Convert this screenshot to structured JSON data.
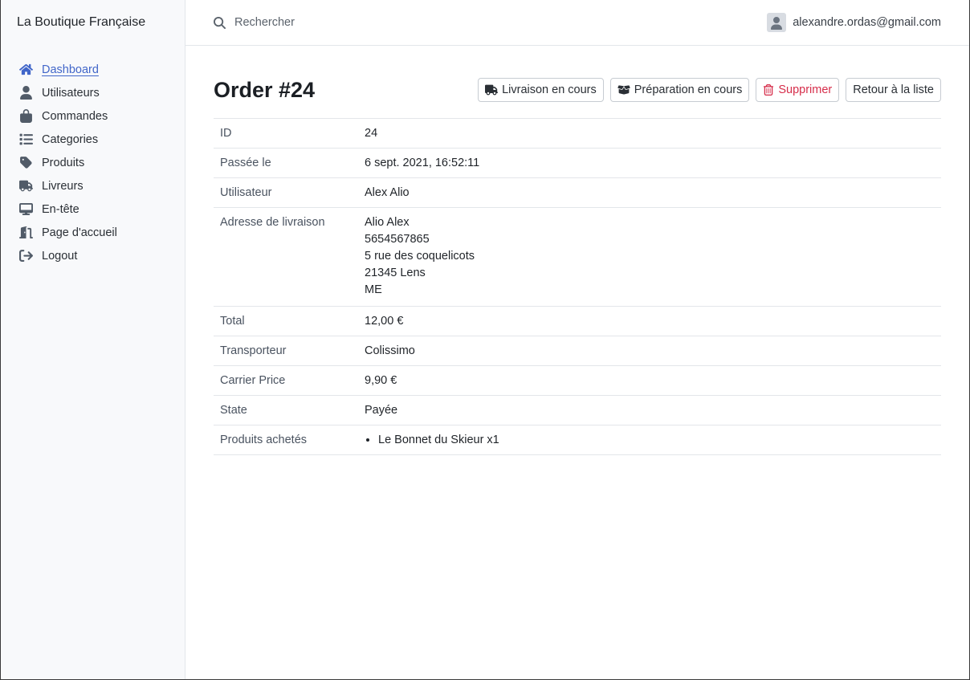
{
  "brand": "La Boutique Française",
  "nav": [
    {
      "label": "Dashboard",
      "icon": "home-icon",
      "active": true
    },
    {
      "label": "Utilisateurs",
      "icon": "user-icon"
    },
    {
      "label": "Commandes",
      "icon": "shopping-bag-icon"
    },
    {
      "label": "Categories",
      "icon": "list-icon"
    },
    {
      "label": "Produits",
      "icon": "tag-icon"
    },
    {
      "label": "Livreurs",
      "icon": "truck-icon"
    },
    {
      "label": "En-tête",
      "icon": "desktop-icon"
    },
    {
      "label": "Page d'accueil",
      "icon": "door-icon"
    },
    {
      "label": "Logout",
      "icon": "sign-out-icon"
    }
  ],
  "search": {
    "placeholder": "Rechercher"
  },
  "user": {
    "email": "alexandre.ordas@gmail.com"
  },
  "page": {
    "title": "Order #24",
    "actions": {
      "delivery": "Livraison en cours",
      "preparation": "Préparation en cours",
      "delete": "Supprimer",
      "back": "Retour à la liste"
    }
  },
  "details": {
    "id": {
      "label": "ID",
      "value": "24"
    },
    "date": {
      "label": "Passée le",
      "value": "6 sept. 2021, 16:52:11"
    },
    "user": {
      "label": "Utilisateur",
      "value": "Alex Alio"
    },
    "address": {
      "label": "Adresse de livraison",
      "lines": [
        "Alio Alex",
        "5654567865",
        "5 rue des coquelicots",
        "21345 Lens",
        "ME"
      ]
    },
    "total": {
      "label": "Total",
      "value": "12,00 €"
    },
    "carrier": {
      "label": "Transporteur",
      "value": "Colissimo"
    },
    "carrier_price": {
      "label": "Carrier Price",
      "value": "9,90 €"
    },
    "state": {
      "label": "State",
      "value": "Payée"
    },
    "products": {
      "label": "Produits achetés",
      "items": [
        "Le Bonnet du Skieur x1"
      ]
    }
  },
  "colors": {
    "accent": "#4166c9",
    "danger": "#d62d4a"
  }
}
